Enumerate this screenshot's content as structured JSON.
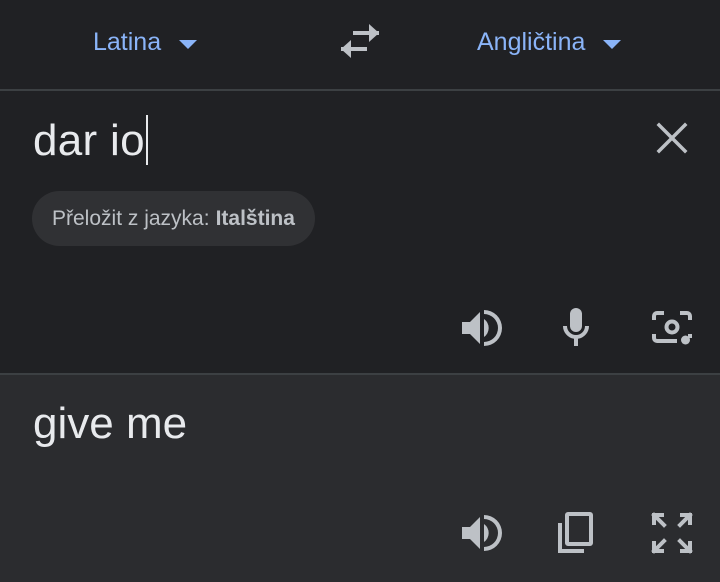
{
  "languages": {
    "source": "Latina",
    "target": "Angličtina"
  },
  "input": {
    "text": "dar io"
  },
  "suggestion": {
    "prefix": "Přeložit z jazyka:",
    "language": "Italština"
  },
  "output": {
    "text": "give me"
  },
  "icons": {
    "swap": "swap-arrows-icon",
    "clear": "close-icon",
    "listen": "speaker-icon",
    "mic": "microphone-icon",
    "camera": "camera-icon",
    "copy": "copy-icon",
    "fullscreen": "fullscreen-icon"
  },
  "colors": {
    "background": "#202124",
    "output_background": "#2b2c2f",
    "accent": "#8ab4f8",
    "text": "#e8eaed",
    "icon": "#bdc1c6"
  }
}
